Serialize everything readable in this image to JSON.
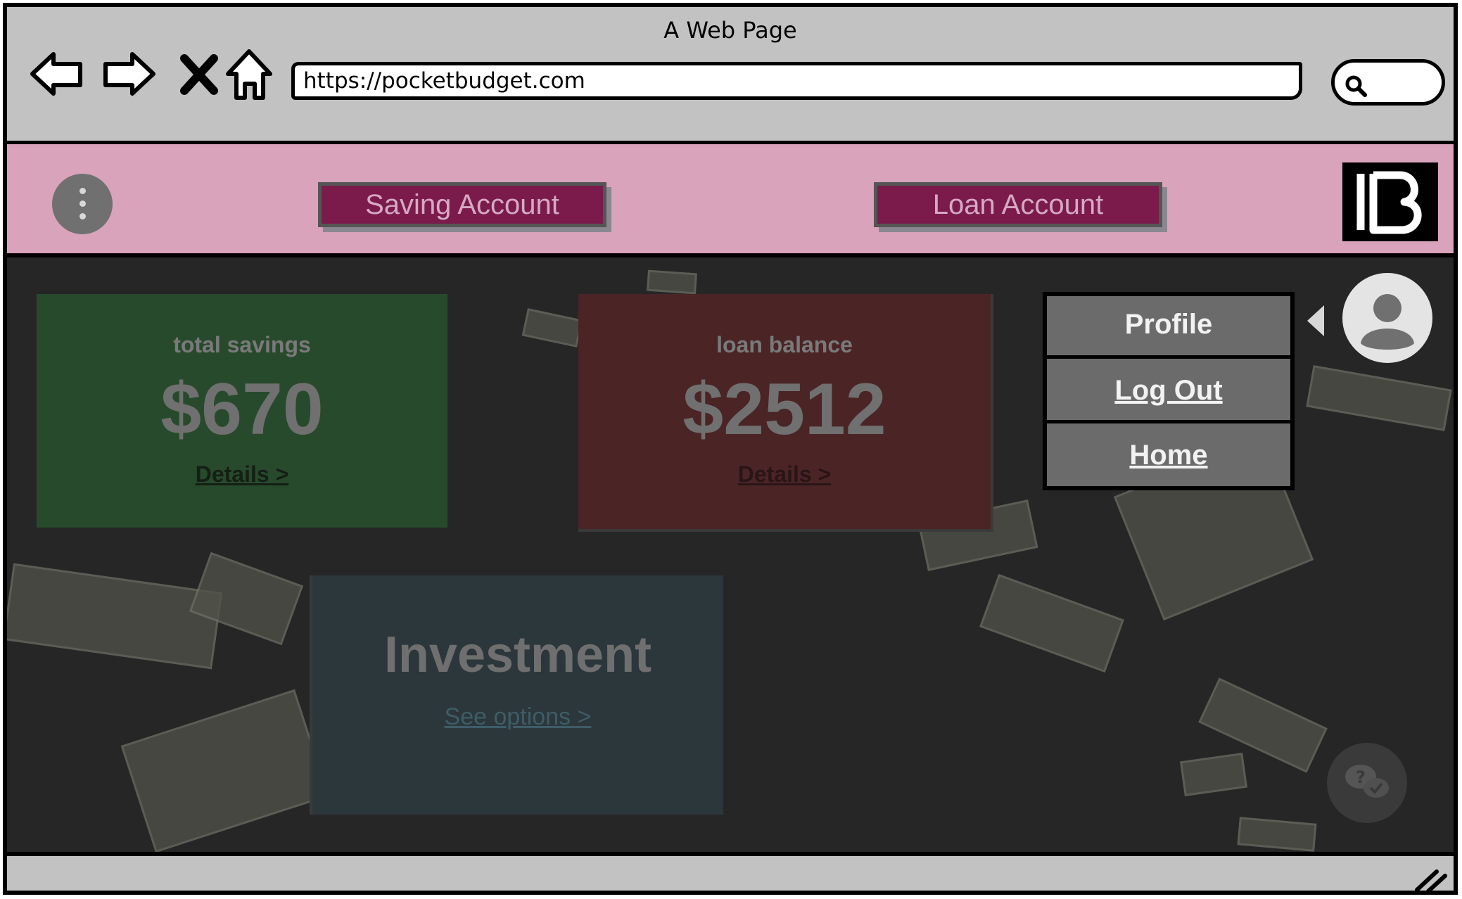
{
  "window": {
    "title": "A Web Page"
  },
  "browser": {
    "url": "https://pocketbudget.com"
  },
  "navbar": {
    "saving_account_label": "Saving Account",
    "loan_account_label": "Loan Account"
  },
  "cards": {
    "savings": {
      "label": "total savings",
      "amount": "$670",
      "link": "Details >"
    },
    "loan": {
      "label": "loan balance",
      "amount": "$2512",
      "link": "Details >"
    },
    "investment": {
      "title": "Investment",
      "link": "See options >"
    }
  },
  "user_menu": {
    "items": [
      {
        "label": "Profile"
      },
      {
        "label": "Log Out"
      },
      {
        "label": "Home"
      }
    ]
  },
  "colors": {
    "header_bg": "#d8a3bb",
    "button_bg": "#7a1b4c",
    "savings_card": "#284a2c",
    "loan_card": "#4b2426",
    "investment_card": "#2c373c",
    "overlay_bg": "#262626"
  },
  "icons": [
    "back-arrow-icon",
    "forward-arrow-icon",
    "close-icon",
    "home-icon",
    "search-icon",
    "kebab-menu-icon",
    "logo-icon",
    "user-avatar-icon",
    "chat-support-icon",
    "resize-grip-icon"
  ]
}
